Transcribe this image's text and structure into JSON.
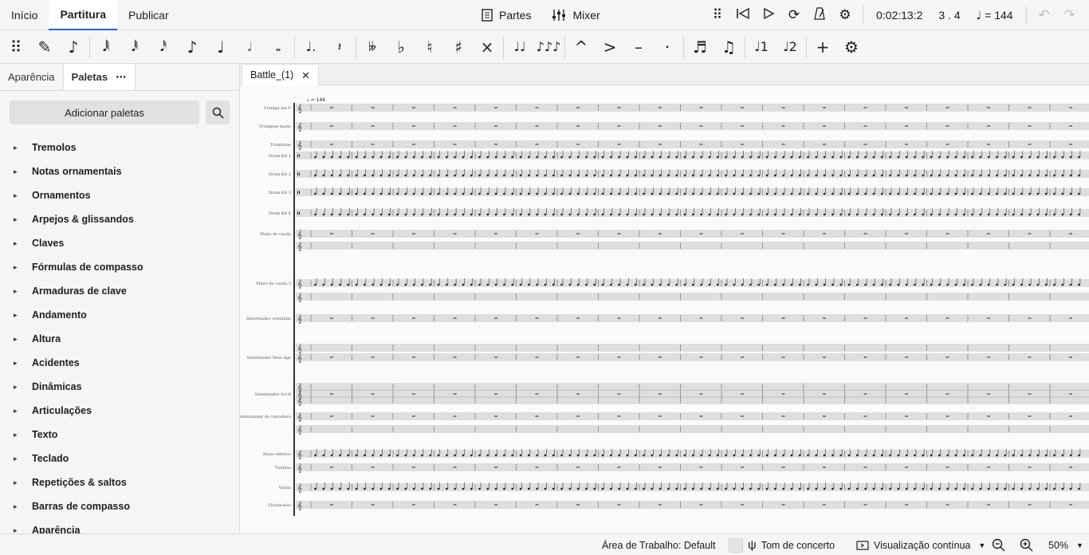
{
  "top_tabs": [
    "Início",
    "Partitura",
    "Publicar"
  ],
  "center_tools": {
    "parts": "Partes",
    "mixer": "Mixer"
  },
  "playback": {
    "time": "0:02:13:2",
    "position": "3 . 4",
    "tempo_value": "= 144"
  },
  "note_toolbar": [
    {
      "name": "drag-handle-icon",
      "glyph": "⠿"
    },
    {
      "name": "pencil-icon",
      "glyph": "✎"
    },
    {
      "name": "note-input-icon",
      "glyph": "♪"
    },
    {
      "sep": true
    },
    {
      "name": "64th-note-icon",
      "glyph": "𝅘𝅥𝅲"
    },
    {
      "name": "32nd-note-icon",
      "glyph": "𝅘𝅥𝅱"
    },
    {
      "name": "16th-note-icon",
      "glyph": "𝅘𝅥𝅰"
    },
    {
      "name": "eighth-note-icon",
      "glyph": "♪"
    },
    {
      "name": "quarter-note-icon",
      "glyph": "♩"
    },
    {
      "name": "half-note-icon",
      "glyph": "𝅗𝅥"
    },
    {
      "name": "whole-note-icon",
      "glyph": "𝅝"
    },
    {
      "sep": true
    },
    {
      "name": "dotted-note-icon",
      "glyph": "♩."
    },
    {
      "name": "rest-icon",
      "glyph": "𝄽"
    },
    {
      "sep": true
    },
    {
      "name": "double-flat-icon",
      "glyph": "𝄫"
    },
    {
      "name": "flat-icon",
      "glyph": "♭"
    },
    {
      "name": "natural-icon",
      "glyph": "♮"
    },
    {
      "name": "sharp-icon",
      "glyph": "♯"
    },
    {
      "name": "double-sharp-icon",
      "glyph": "×"
    },
    {
      "sep": true
    },
    {
      "name": "tie-icon",
      "glyph": "♩♩"
    },
    {
      "name": "slur-icon",
      "glyph": "♪♪♪"
    },
    {
      "sep": true
    },
    {
      "name": "marcato-icon",
      "glyph": "^"
    },
    {
      "name": "accent-icon",
      "glyph": ">"
    },
    {
      "name": "tenuto-icon",
      "glyph": "–"
    },
    {
      "name": "staccato-icon",
      "glyph": "·"
    },
    {
      "sep": true
    },
    {
      "name": "tuplet-icon",
      "glyph": "♬"
    },
    {
      "name": "flip-direction-icon",
      "glyph": "♫"
    },
    {
      "sep": true
    },
    {
      "name": "voice-1-icon",
      "glyph": "♩1"
    },
    {
      "name": "voice-2-icon",
      "glyph": "♩2"
    },
    {
      "sep": true
    },
    {
      "name": "add-icon",
      "glyph": "+"
    },
    {
      "name": "toolbar-settings-icon",
      "glyph": "⚙"
    }
  ],
  "sidebar": {
    "tabs": [
      "Aparência",
      "Paletas"
    ],
    "add_palettes": "Adicionar paletas",
    "palettes": [
      "Tremolos",
      "Notas ornamentais",
      "Ornamentos",
      "Arpejos & glissandos",
      "Claves",
      "Fórmulas de compasso",
      "Armaduras de clave",
      "Andamento",
      "Altura",
      "Acidentes",
      "Dinâmicas",
      "Articulações",
      "Texto",
      "Teclado",
      "Repetições & saltos",
      "Barras de compasso",
      "Aparência"
    ]
  },
  "score": {
    "tab_title": "Battle_(1)",
    "tempo_mark": "♩ = 144",
    "instruments": [
      "Trompa em F",
      "Trompete mudo",
      "Trombone",
      "Drum Kit 1",
      "Drum Kit 2",
      "Drum Kit 3",
      "Drum Kit 4",
      "Piano de cauda",
      "Piano de cauda 2",
      "Sintetizador cristalino",
      "Sintetizador New Age",
      "Sintetizador Sci-fi",
      "Sintetizador de varredura",
      "Baixo elétrico",
      "Violinos",
      "Violas",
      "Violoncelos"
    ]
  },
  "status": {
    "workspace": "Área de Trabalho: Default",
    "concert_pitch": "Tom de concerto",
    "view_mode": "Visualização contínua",
    "zoom": "50%"
  },
  "colors": {
    "accent": "#2b5fd9",
    "bg": "#f5f5f6",
    "paper": "#fafafa"
  }
}
